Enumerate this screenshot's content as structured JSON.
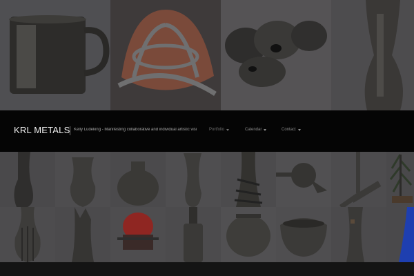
{
  "site": {
    "brand": "KRL METALS",
    "tagline": "Kelly Ludeking - Manifesting collaborative and individual artistic visi"
  },
  "nav": [
    {
      "label": "Portfolio",
      "has_dropdown": true
    },
    {
      "label": "Calendar",
      "has_dropdown": true
    },
    {
      "label": "Contact",
      "has_dropdown": true
    }
  ],
  "gallery": {
    "featured": [
      "metal-mug",
      "glass-in-metal-cage",
      "rough-metal-chunks",
      "textured-vase"
    ],
    "row1": [
      "tall-vase",
      "twisted-vase",
      "round-pot",
      "slender-vase",
      "wrapped-vessel",
      "spouted-vessel",
      "branch-sculpture",
      "tree-sculpture"
    ],
    "row2": [
      "fluted-vase",
      "torn-vase",
      "red-glass-vessel",
      "bottle-sculpture",
      "round-vessel",
      "wide-bowl",
      "tall-rough-vase",
      "blue-accent"
    ]
  },
  "colors": {
    "header_bg": "#050505",
    "brand_text": "#f2f2f2",
    "nav_text": "#8c8c8c",
    "tile_bg": "#4a4a4a",
    "accent_red": "#b8302c",
    "accent_blue": "#1e3fb0"
  }
}
